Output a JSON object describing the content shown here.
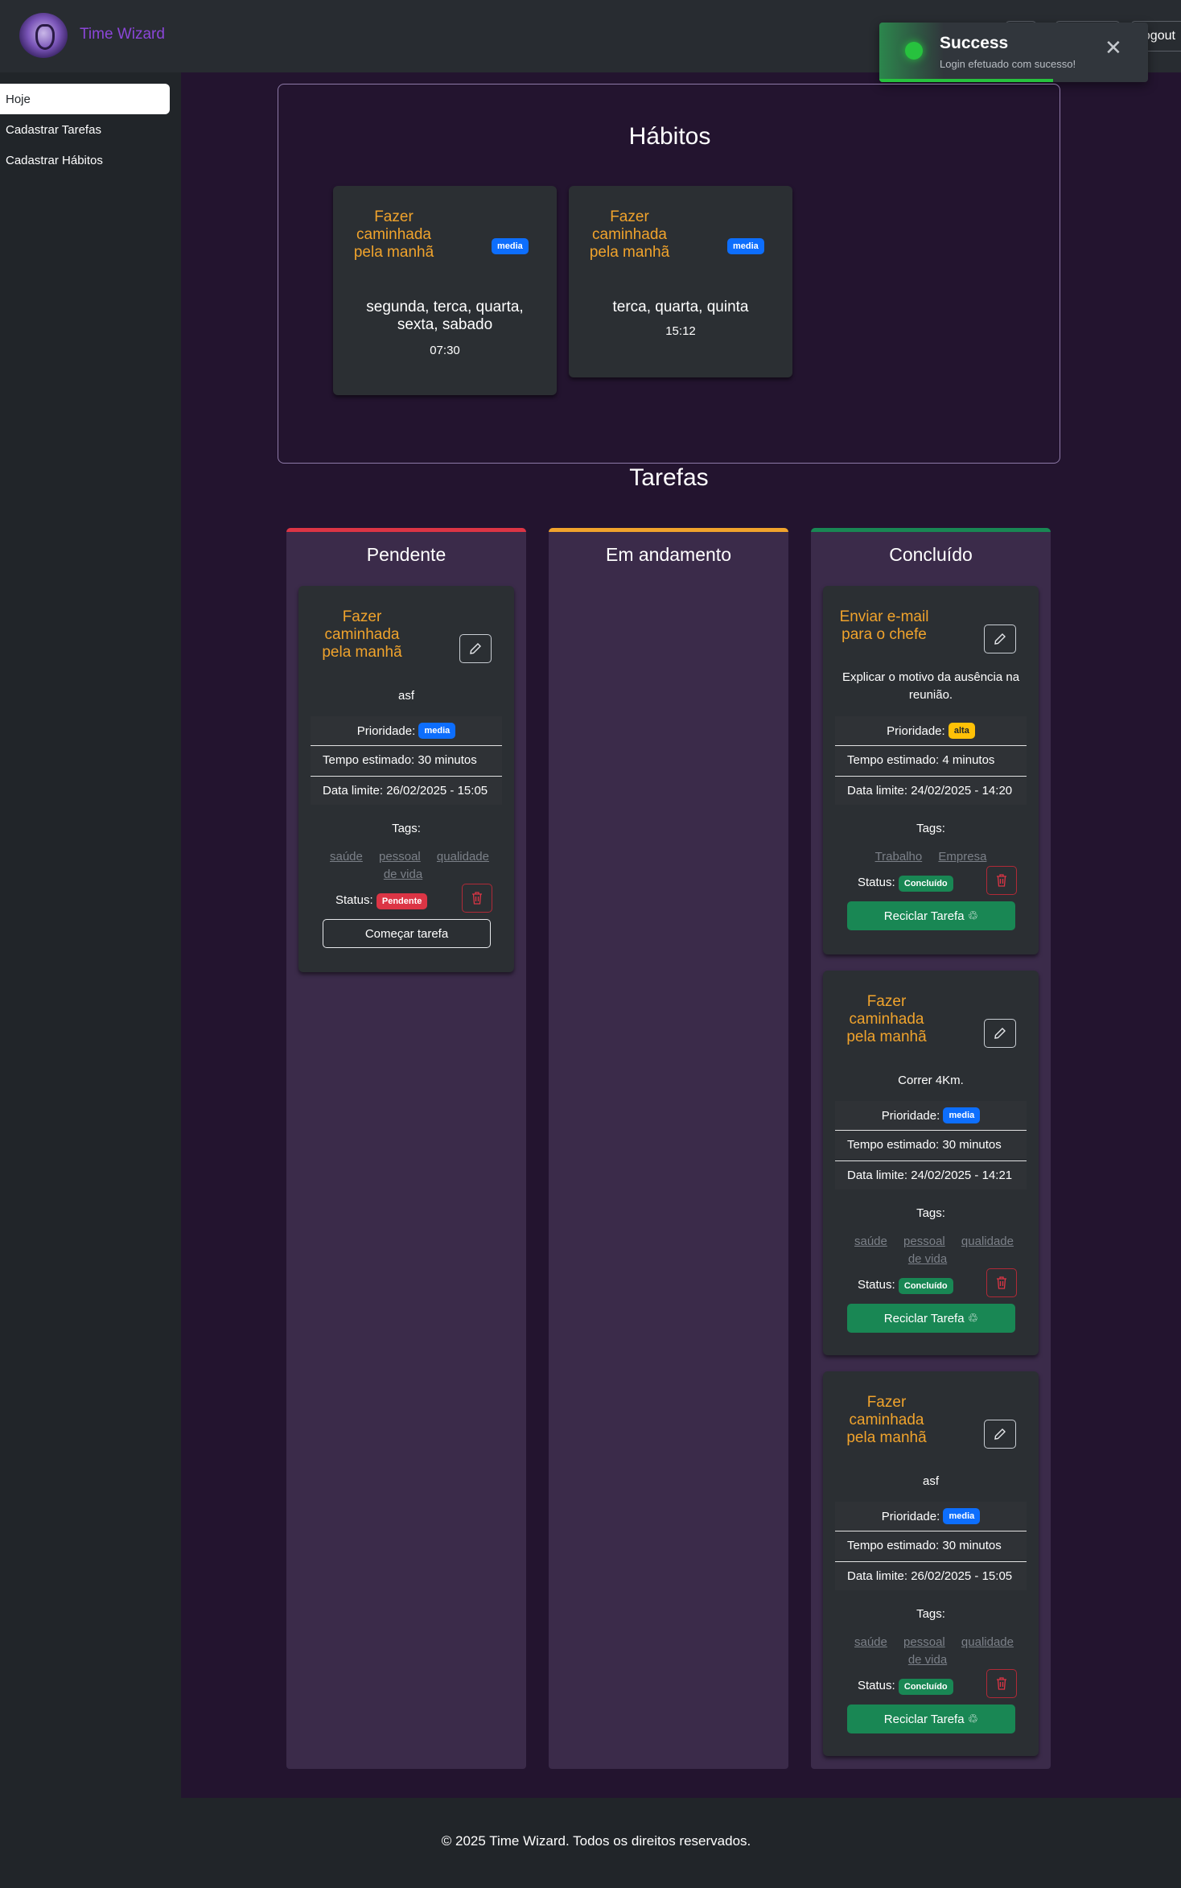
{
  "app": {
    "brand": "Time Wizard"
  },
  "header": {
    "buttons": [
      "",
      "",
      "Logout"
    ]
  },
  "toast": {
    "title": "Success",
    "message": "Login efetuado com sucesso!",
    "close": "✕",
    "type": "success"
  },
  "sidebar": {
    "items": [
      {
        "label": "Hoje",
        "active": true
      },
      {
        "label": "Cadastrar Tarefas",
        "active": false
      },
      {
        "label": "Cadastrar Hábitos",
        "active": false
      }
    ]
  },
  "habits": {
    "title": "Hábitos",
    "cards": [
      {
        "title": "Fazer caminhada pela manhã",
        "priority": "media",
        "days": "segunda, terca, quarta, sexta, sabado",
        "time": "07:30"
      },
      {
        "title": "Fazer caminhada pela manhã",
        "priority": "media",
        "days": "terca, quarta, quinta",
        "time": "15:12"
      }
    ]
  },
  "tasks": {
    "title": "Tarefas",
    "columns": [
      {
        "title": "Pendente",
        "color": "#dc3545"
      },
      {
        "title": "Em andamento",
        "color": "#f0a32c"
      },
      {
        "title": "Concluído",
        "color": "#198754"
      }
    ],
    "labels": {
      "priority": "Prioridade:",
      "estimated": "Tempo estimado:",
      "deadline": "Data limite:",
      "tags": "Tags:",
      "status": "Status:",
      "start": "Começar tarefa",
      "recycle": "Reciclar Tarefa ♲"
    },
    "pending": [
      {
        "title": "Fazer caminhada pela manhã",
        "description": "asf",
        "priority": "media",
        "estimated": "Tempo estimado: 30 minutos",
        "deadline": "Data limite: 26/02/2025 - 15:05",
        "tags": [
          "saúde",
          "pessoal",
          "qualidade de vida"
        ],
        "status": "Pendente"
      }
    ],
    "done": [
      {
        "title": "Enviar e-mail para o chefe",
        "description": "Explicar o motivo da ausência na reunião.",
        "priority": "alta",
        "estimated": "Tempo estimado: 4 minutos",
        "deadline": "Data limite: 24/02/2025 - 14:20",
        "tags": [
          "Trabalho",
          "Empresa"
        ],
        "status": "Concluído"
      },
      {
        "title": "Fazer caminhada pela manhã",
        "description": "Correr 4Km.",
        "priority": "media",
        "estimated": "Tempo estimado: 30 minutos",
        "deadline": "Data limite: 24/02/2025 - 14:21",
        "tags": [
          "saúde",
          "pessoal",
          "qualidade de vida"
        ],
        "status": "Concluído"
      },
      {
        "title": "Fazer caminhada pela manhã",
        "description": "asf",
        "priority": "media",
        "estimated": "Tempo estimado: 30 minutos",
        "deadline": "Data limite: 26/02/2025 - 15:05",
        "tags": [
          "saúde",
          "pessoal",
          "qualidade de vida"
        ],
        "status": "Concluído"
      }
    ]
  },
  "colors": {
    "media": "#0d6efd",
    "alta": "#ffc107",
    "pendente": "#dc3545",
    "concluido": "#198754"
  },
  "footer": {
    "text": "© 2025 Time Wizard. Todos os direitos reservados."
  }
}
